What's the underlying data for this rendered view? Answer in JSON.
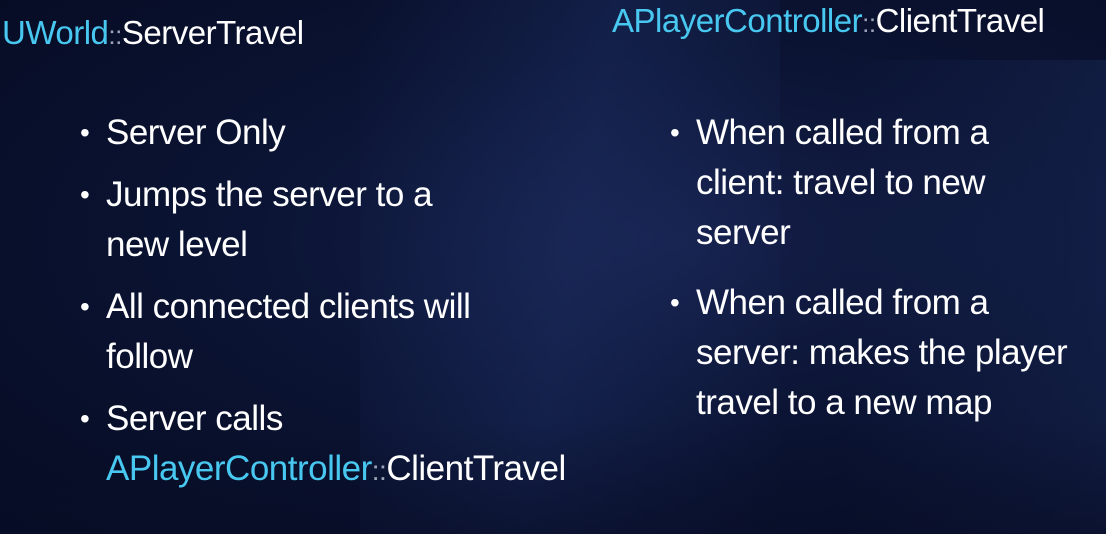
{
  "left_column": {
    "title": {
      "class_name": "UWorld",
      "separator": "::",
      "function_name": "ServerTravel"
    },
    "bullets": [
      "Server Only",
      "Jumps the server to a new level",
      "All connected clients will follow",
      "Server calls"
    ],
    "last_bullet_ref": {
      "class_name": "APlayerController",
      "separator": "::",
      "function_name": "ClientTravel"
    }
  },
  "right_column": {
    "title": {
      "class_name": "APlayerController",
      "separator": "::",
      "function_name": "ClientTravel"
    },
    "bullets": [
      "When called from a client: travel to new server",
      "When called from a server: makes the player travel to a new map"
    ]
  },
  "colors": {
    "class_name": "#48c8f0",
    "text": "#ffffff",
    "background": "#0b1434"
  }
}
